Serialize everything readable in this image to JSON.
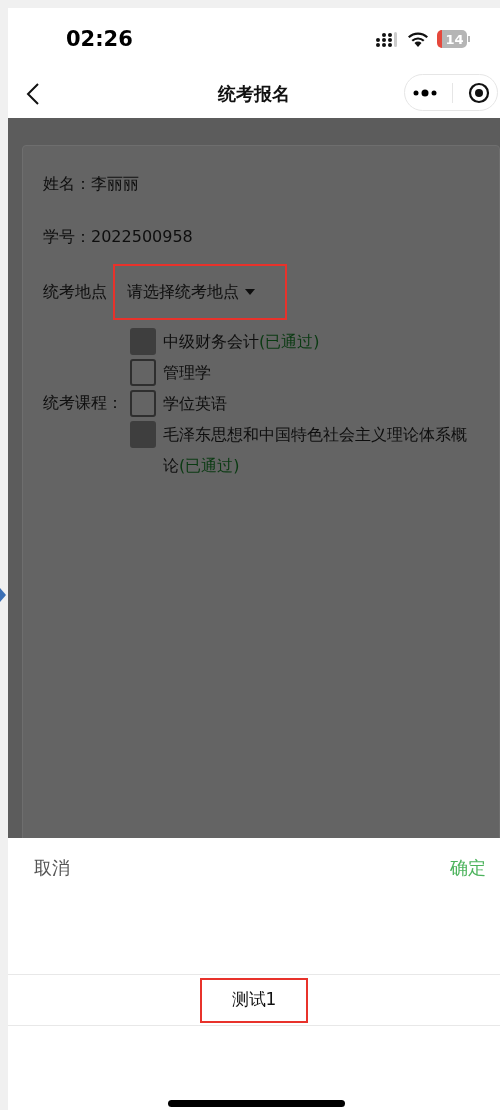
{
  "status_bar": {
    "time": "02:26",
    "battery": "14"
  },
  "nav_bar": {
    "title": "统考报名"
  },
  "form": {
    "name_label": "姓名：",
    "name_value": "李丽丽",
    "id_label": "学号：",
    "id_value": "2022500958",
    "location_label": "统考地点",
    "location_placeholder": "请选择统考地点",
    "location_annotated": true,
    "courses_label": "统考课程：",
    "courses": [
      {
        "name": "中级财务会计",
        "note": "(已通过)",
        "checked": false,
        "disabled": true
      },
      {
        "name": "管理学",
        "checked": false,
        "disabled": false
      },
      {
        "name": "学位英语",
        "checked": false,
        "disabled": false
      },
      {
        "name": "毛泽东思想和中国特色社会主义理论体系概论",
        "note": "(已通过)",
        "checked": false,
        "disabled": true
      }
    ]
  },
  "picker": {
    "cancel": "取消",
    "confirm": "确定",
    "options": [
      {
        "label": "测试1",
        "selected": true,
        "annotated": true
      }
    ]
  }
}
